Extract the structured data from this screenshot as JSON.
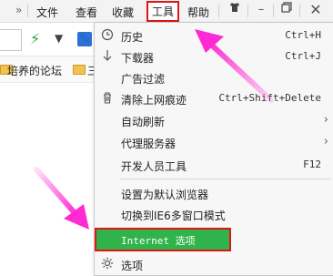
{
  "menubar": {
    "items": [
      {
        "label": "文件"
      },
      {
        "label": "查看"
      },
      {
        "label": "收藏"
      },
      {
        "label": "工具"
      },
      {
        "label": "帮助"
      }
    ]
  },
  "bookmarks": {
    "items": [
      {
        "label": "培养的论坛"
      },
      {
        "label": "三"
      }
    ]
  },
  "dropdown": {
    "items": [
      {
        "label": "历史",
        "shortcut": "Ctrl+H",
        "icon": "clock-icon"
      },
      {
        "label": "下载器",
        "shortcut": "Ctrl+J",
        "icon": "download-icon"
      },
      {
        "label": "广告过滤",
        "shortcut": "",
        "icon": ""
      },
      {
        "label": "清除上网痕迹",
        "shortcut": "Ctrl+Shift+Delete",
        "icon": "trash-icon"
      },
      {
        "label": "自动刷新",
        "shortcut": "",
        "icon": ""
      },
      {
        "label": "代理服务器",
        "shortcut": "",
        "icon": ""
      },
      {
        "label": "开发人员工具",
        "shortcut": "F12",
        "icon": ""
      },
      {
        "label": "设置为默认浏览器",
        "shortcut": "",
        "icon": ""
      },
      {
        "label": "切换到IE6多窗口模式",
        "shortcut": "",
        "icon": ""
      },
      {
        "label": "Internet 选项",
        "shortcut": "",
        "icon": ""
      },
      {
        "label": "选项",
        "shortcut": "",
        "icon": "gear-icon"
      }
    ]
  },
  "colors": {
    "highlight_border": "#e01515",
    "active_item_bg": "#2fb34a",
    "arrow": "#ff2ad4"
  }
}
